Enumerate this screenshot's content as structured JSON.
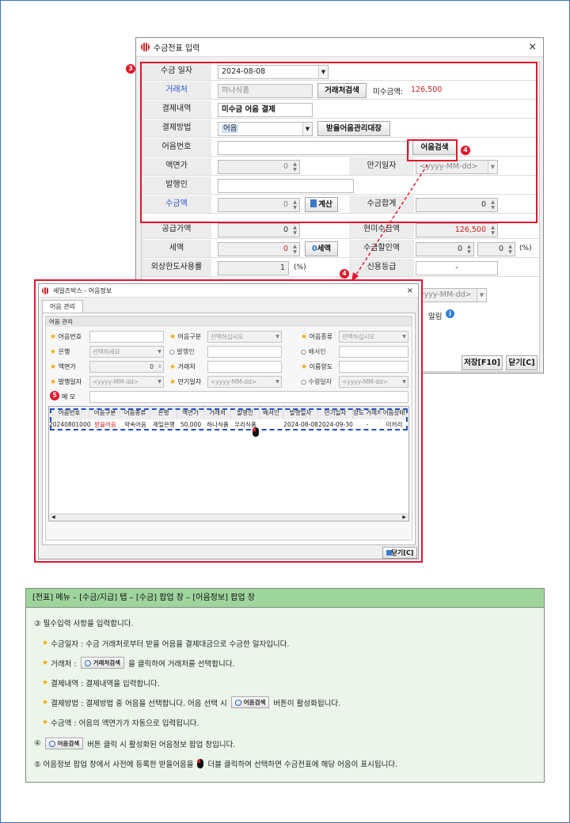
{
  "main_window": {
    "title": "수금전표 입력",
    "close_glyph": "×",
    "fields": {
      "date_label": "수금 일자",
      "date_value": "2024-08-08",
      "client_label": "거래처",
      "client_value": "하나식품",
      "client_search_btn": "거래처검색",
      "unpaid_label": "미수금액:",
      "unpaid_value": "126,500",
      "payment_note_label": "결제내역",
      "payment_note_value": "미수금 어음 결제",
      "payment_method_label": "결제방법",
      "payment_method_value": "어음",
      "bill_ledger_btn": "받을어음관리대장",
      "bill_no_label": "어음번호",
      "bill_search_btn": "어음검색",
      "face_value_label": "액면가",
      "face_value": "0",
      "due_date_label": "만기일자",
      "due_date_placeholder": "<yyyy-MM-dd>",
      "issuer_label": "발행인",
      "amount_label": "수금액",
      "amount_value": "0",
      "calc_btn": "계산",
      "total_label": "수금합계",
      "total_value": "0",
      "supply_label": "공급가액",
      "supply_value": "0",
      "unpaid_now_label": "현미수금액",
      "unpaid_now_value": "126,500",
      "tax_label": "세액",
      "tax_value": "0",
      "tax_btn": "세액",
      "discount_label": "수금할인액",
      "discount_value1": "0",
      "discount_value2": "0",
      "discount_unit": "(%)",
      "credit_label": "외상한도사용률",
      "credit_value": "1",
      "credit_unit": "(%)",
      "grade_label": "신용등급",
      "grade_value": "-",
      "date_ph2": "yyyy-MM-dd>",
      "notify": "알림"
    },
    "save_btn": "저장[F10]",
    "close_btn": "닫기[C]"
  },
  "badges": {
    "b3": "3",
    "b4": "4",
    "b4b": "4",
    "b5": "5"
  },
  "popup": {
    "title": "세일즈박스 - 어음정보",
    "tab": "어음 관리",
    "group": "어음 관리",
    "fields": {
      "bill_no": "어음번호",
      "bill_type": "어음구분",
      "bill_type_ph": "선택하십시오",
      "bill_kind": "어음종류",
      "bill_kind_ph": "선택하십시오",
      "bank": "은행",
      "bank_ph": "선택하세요",
      "issuer": "발행인",
      "endorser": "배서인",
      "face": "액면가",
      "face_value": "0",
      "client": "거래처",
      "transferee": "이름양도",
      "issue_date": "발행일자",
      "date_ph": "<yyyy-MM-dd>",
      "due_date": "만기일자",
      "receipt_date": "수령일자",
      "memo": "메 모"
    },
    "grid": {
      "headers": [
        "어음번호",
        "어음구분",
        "어음종류",
        "은행",
        "액면가",
        "거래처",
        "발행인",
        "배서인",
        "발행일자",
        "만기일자",
        "양도 거래처",
        "어음상태"
      ],
      "row": [
        "202408010001",
        "받을어음",
        "약속어음",
        "제일은행",
        "50,000",
        "하나식품",
        "우리식품",
        "",
        "2024-08-08",
        "2024-09-30",
        "-",
        "미처리"
      ]
    },
    "close_btn": "닫기[C]"
  },
  "info": {
    "header": "[전표] 메뉴 – [수금/지급] 탭 – [수금] 팝업 창 – [어음정보] 팝업 창",
    "l1": "③  필수입력 사항을 입력합니다.",
    "l2": "수금일자 : 수금 거래처로부터 받을 어음을 결제대금으로 수금한 일자입니다.",
    "l3a": "거래처 :",
    "l3btn": "거래처검색",
    "l3b": "을 클릭하여 거래처를 선택합니다.",
    "l4": "결제내역 :  결제내역을 입력합니다.",
    "l5a": "결제방법 :  결제방법 중 어음을 선택합니다. 어음 선택 시",
    "l5btn": "어음검색",
    "l5b": "버튼이 활성화됩니다.",
    "l6": "수금액 : 어음의 액면가가 자동으로 입력됩니다.",
    "l7a": "④",
    "l7btn": "어음검색",
    "l7b": "버튼 클릭 시 활성화된 어음정보 팝업 창입니다.",
    "l8a": "⑤  어음정보 팝업 창에서 사전에 등록한 받을어음을",
    "l8b": "더블 클릭하여 선택하면 수금전표에 해당 어음이 표시됩니다."
  },
  "colors": {
    "accent_red": "#e3162c",
    "dashed_blue": "#1f4fd1",
    "label_blue": "#2b57d4",
    "info_green": "#9ed59d"
  }
}
